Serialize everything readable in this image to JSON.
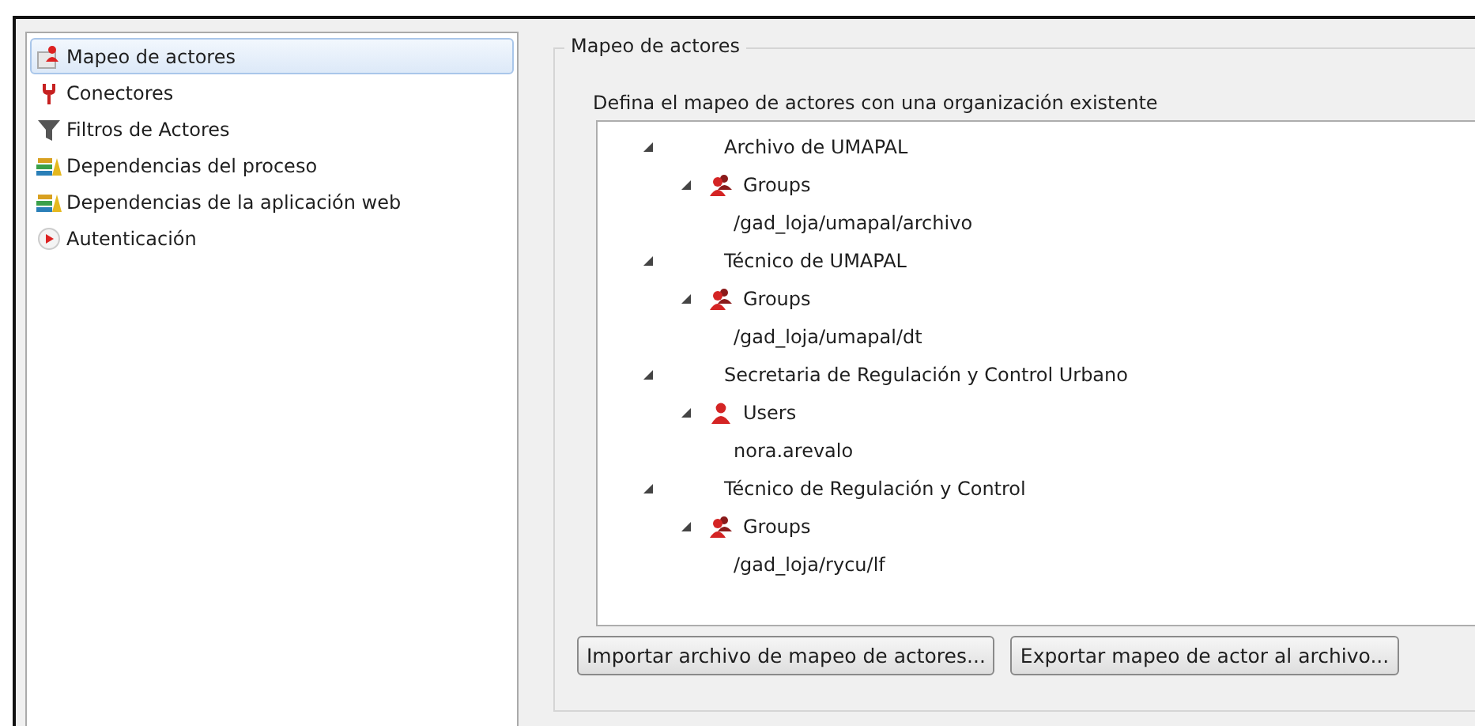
{
  "sidebar": {
    "items": [
      {
        "label": "Mapeo de actores",
        "kind": "mapping",
        "selected": true
      },
      {
        "label": "Conectores",
        "kind": "connector",
        "selected": false
      },
      {
        "label": "Filtros de Actores",
        "kind": "filter",
        "selected": false
      },
      {
        "label": "Dependencias del proceso",
        "kind": "dependency",
        "selected": false
      },
      {
        "label": "Dependencias de la aplicación web",
        "kind": "dependency",
        "selected": false
      },
      {
        "label": "Autenticación",
        "kind": "auth",
        "selected": false
      }
    ]
  },
  "group": {
    "title": "Mapeo de actores",
    "description": "Defina el mapeo de actores con una organización existente",
    "tree": [
      {
        "label": "Archivo de UMAPAL",
        "expanded": true,
        "children": [
          {
            "label": "Groups",
            "kind": "groups",
            "expanded": true,
            "children": [
              {
                "label": "/gad_loja/umapal/archivo"
              }
            ]
          }
        ]
      },
      {
        "label": "Técnico de UMAPAL",
        "expanded": true,
        "children": [
          {
            "label": "Groups",
            "kind": "groups",
            "expanded": true,
            "children": [
              {
                "label": "/gad_loja/umapal/dt"
              }
            ]
          }
        ]
      },
      {
        "label": "Secretaria de Regulación y Control Urbano",
        "expanded": true,
        "children": [
          {
            "label": "Users",
            "kind": "users",
            "expanded": true,
            "children": [
              {
                "label": "nora.arevalo"
              }
            ]
          }
        ]
      },
      {
        "label": "Técnico de Regulación y Control",
        "expanded": true,
        "children": [
          {
            "label": "Groups",
            "kind": "groups",
            "expanded": true,
            "children": [
              {
                "label": "/gad_loja/rycu/lf"
              }
            ]
          }
        ]
      }
    ],
    "buttons": [
      "Importar archivo de mapeo de actores...",
      "Exportar mapeo de actor al archivo..."
    ]
  }
}
